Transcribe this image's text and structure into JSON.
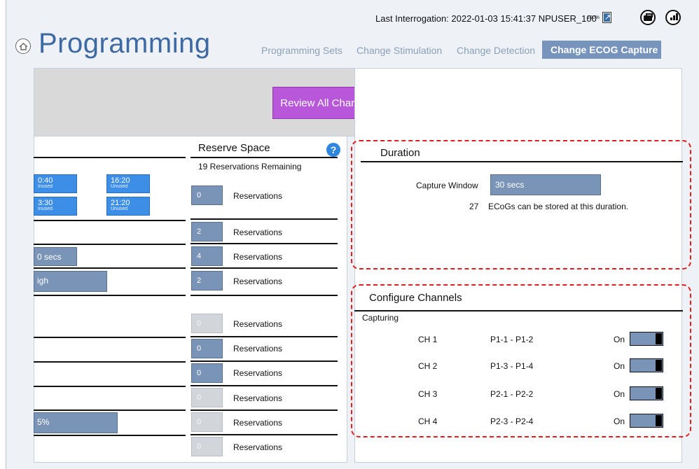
{
  "header": {
    "last_interrogation": "Last Interrogation: 2022-01-03 15:41:37  NPUSER_100",
    "battery_percent": "100%"
  },
  "page_title": "Programming",
  "tabs": [
    {
      "label": "Programming Sets"
    },
    {
      "label": "Change Stimulation"
    },
    {
      "label": "Change Detection"
    },
    {
      "label": "Change ECOG Capture",
      "active": true
    }
  ],
  "review_button": "Review All Changes",
  "left": {
    "time_chips": [
      {
        "time": "0:40",
        "status": "Inused"
      },
      {
        "time": "16:20",
        "status": "Unused"
      },
      {
        "time": "3:30",
        "status": "Inused"
      },
      {
        "time": "21:20",
        "status": "Unused"
      }
    ],
    "secs_bar": "0 secs",
    "high_bar": "igh",
    "pct_bar": "5%"
  },
  "reserve": {
    "title": "Reserve Space",
    "help": "?",
    "remaining": "19 Reservations Remaining",
    "rows": [
      {
        "value": "0",
        "label": "Reservations",
        "enabled": true
      },
      {
        "value": "2",
        "label": "Reservations",
        "enabled": true
      },
      {
        "value": "4",
        "label": "Reservations",
        "enabled": true
      },
      {
        "value": "2",
        "label": "Reservations",
        "enabled": true
      },
      {
        "value": "0",
        "label": "Reservations",
        "enabled": false
      },
      {
        "value": "0",
        "label": "Reservations",
        "enabled": true
      },
      {
        "value": "0",
        "label": "Reservations",
        "enabled": true
      },
      {
        "value": "0",
        "label": "Reservations",
        "enabled": false
      },
      {
        "value": "0",
        "label": "Reservations",
        "enabled": false
      },
      {
        "value": "0",
        "label": "Reservations",
        "enabled": false
      }
    ]
  },
  "duration": {
    "title": "Duration",
    "capture_window_label": "Capture Window",
    "capture_window_value": "30 secs",
    "ecog_count": "27",
    "ecog_text": "ECoGs can be stored at this duration."
  },
  "channels": {
    "title": "Configure Channels",
    "capturing_label": "Capturing",
    "rows": [
      {
        "name": "CH 1",
        "pair": "P1-1 - P1-2",
        "state": "On"
      },
      {
        "name": "CH 2",
        "pair": "P1-3 - P1-4",
        "state": "On"
      },
      {
        "name": "CH 3",
        "pair": "P2-1 - P2-2",
        "state": "On"
      },
      {
        "name": "CH 4",
        "pair": "P2-3 - P2-4",
        "state": "On"
      }
    ]
  },
  "colors": {
    "accent": "#3d6aa3",
    "active_tab": "#7794bd",
    "review_button": "#b957db",
    "time_chip": "#3d8ee6",
    "input_fill": "#7a94b8",
    "annotation": "#e02020"
  }
}
